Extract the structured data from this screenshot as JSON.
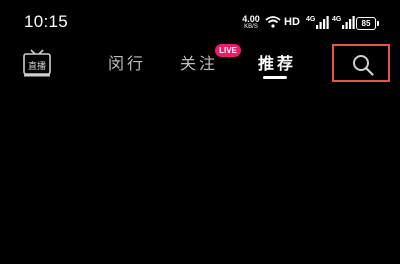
{
  "status_bar": {
    "time": "10:15",
    "net_speed_value": "4.00",
    "net_speed_unit": "KB/S",
    "hd_label": "HD",
    "signal_1": "4G",
    "signal_2": "4G",
    "battery": "85"
  },
  "nav": {
    "live_icon_label": "直播",
    "tabs": [
      {
        "label": "闵行"
      },
      {
        "label": "关注"
      },
      {
        "label": "推荐"
      }
    ],
    "active_tab": "推荐",
    "live_badge": "LIVE"
  },
  "colors": {
    "background": "#000000",
    "live_badge": "#f0196a",
    "highlight_box": "#e8534f"
  },
  "icons": {
    "search": "search-icon",
    "live_tv": "live-tv-icon",
    "wifi": "wifi-icon"
  }
}
